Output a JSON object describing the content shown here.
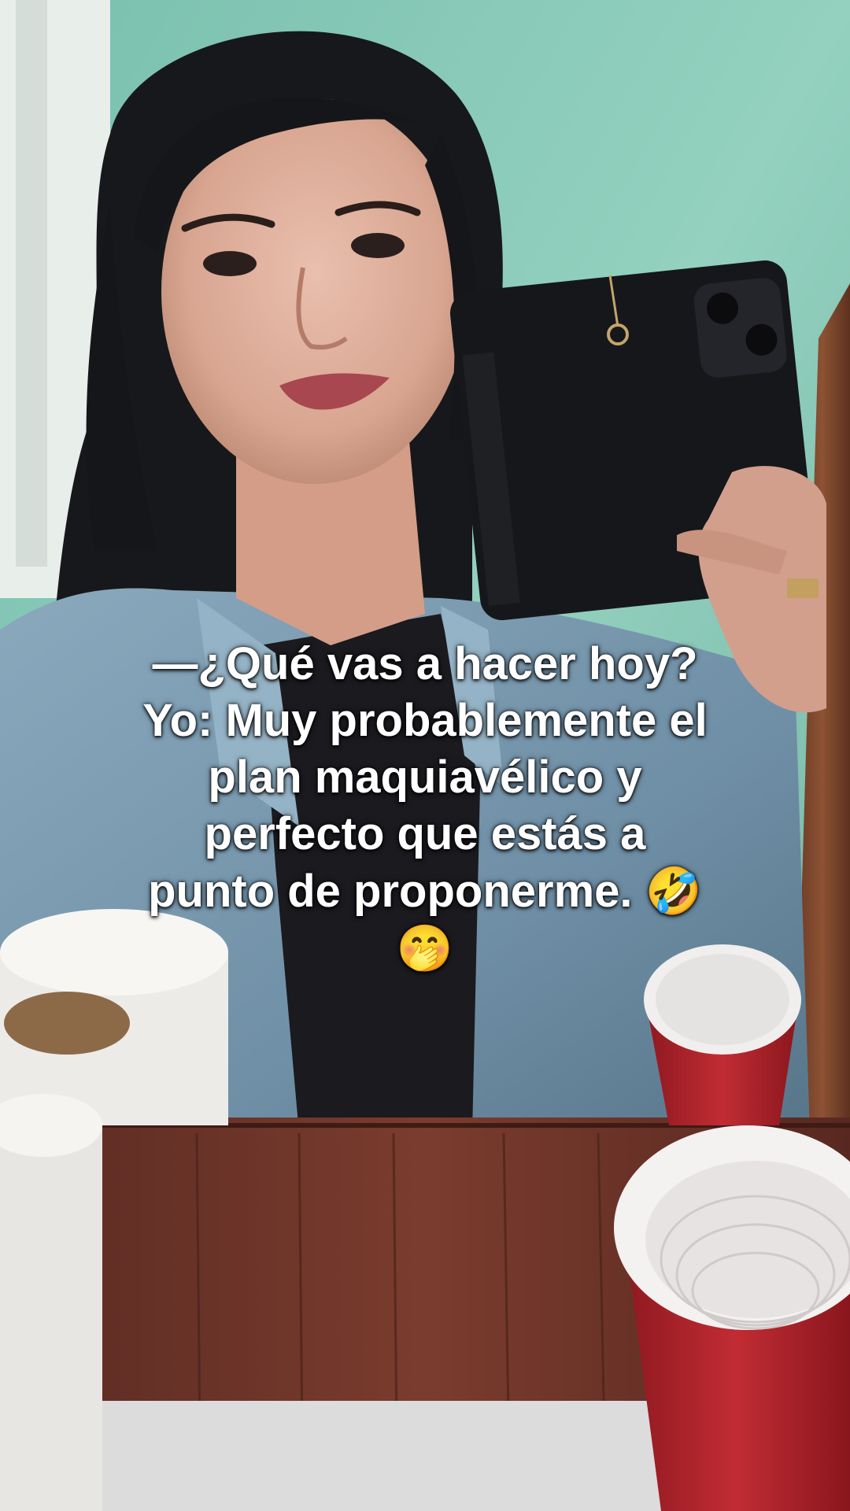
{
  "caption": {
    "lines": [
      "—¿Qué vas a hacer hoy?",
      "Yo: Muy probablemente el",
      "plan maquiavélico y",
      "perfecto que estás a",
      "punto de proponerme."
    ],
    "emoji_rofl": "🤣",
    "emoji_hand_over_mouth": "🤭"
  },
  "colors": {
    "wall": "#8ec9b6",
    "hair": "#15161a",
    "jacket": "#7f9fb4",
    "wood": "#6a3327",
    "cup_red": "#b0232b",
    "paper": "#e9e7e4"
  }
}
